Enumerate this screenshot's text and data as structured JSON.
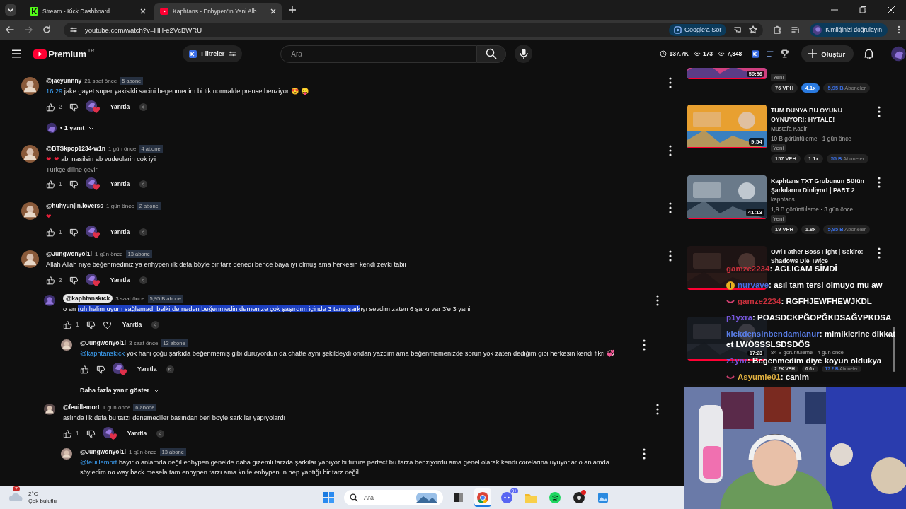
{
  "browser": {
    "tabs": [
      {
        "title": "Stream - Kick Dashboard",
        "kind": "kick",
        "selected": false
      },
      {
        "title": "Kaphtans - Enhypen'ın Yeni Alb",
        "kind": "youtube",
        "selected": true
      }
    ],
    "address": "youtube.com/watch?v=HH-e2VcBWRU",
    "ask_button": "Google'a Sor",
    "profile_button": "Kimliğinizi doğrulayın"
  },
  "header": {
    "logo": "Premium",
    "region": "TR",
    "filters": "Filtreler",
    "search": {
      "placeholder": "Ara"
    },
    "stats": [
      {
        "kind": "clock",
        "value": "137.7K"
      },
      {
        "kind": "eye",
        "value": "173"
      },
      {
        "kind": "eye",
        "value": "7,848"
      }
    ],
    "create": "Oluştur"
  },
  "comments": [
    {
      "author": "@jaeyunnny",
      "owner": false,
      "time": "21 saat önce",
      "subscribers": "5 abone",
      "segments": [
        {
          "kind": "link",
          "text": "16:29"
        },
        {
          "kind": "plain",
          "text": " jake gayet super yakisikli sacini begenmedim bi tik normalde prense benziyor 😍 😛"
        }
      ],
      "likes": "2",
      "hearted": true,
      "reply_label": "Yanıtla",
      "replies_toggle": "• 1 yanıt"
    },
    {
      "author": "@BTSkpop1234-w1n",
      "owner": false,
      "time": "1 gün önce",
      "subscribers": "4 abone",
      "segments": [
        {
          "kind": "heart",
          "text": "❤ ❤"
        },
        {
          "kind": "plain",
          "text": " abi nasilsin ab vudeolarin cok iyii"
        }
      ],
      "translate": "Türkçe diline çevir",
      "likes": "1",
      "hearted": true,
      "reply_label": "Yanıtla"
    },
    {
      "author": "@huhyunjin.loverss",
      "owner": false,
      "time": "1 gün önce",
      "subscribers": "2 abone",
      "segments": [
        {
          "kind": "heart",
          "text": "❤"
        }
      ],
      "likes": "1",
      "hearted": true,
      "reply_label": "Yanıtla"
    },
    {
      "author": "@Jungwonyoi1i",
      "owner": false,
      "time": "1 gün önce",
      "subscribers": "13 abone",
      "segments": [
        {
          "kind": "plain",
          "text": "Allah Allah niye beğenmediniz ya enhypen ilk defa böyle bir tarz denedi bence baya iyi olmuş ama herkesin kendi zevki tabii"
        }
      ],
      "likes": "2",
      "hearted": true,
      "reply_label": "Yanıtla",
      "children": [
        {
          "author": "@kaphtanskick",
          "owner": true,
          "time": "3 saat önce",
          "subscribers": "5,95 B abone",
          "segments": [
            {
              "kind": "plain",
              "text": "o an "
            },
            {
              "kind": "selected",
              "text": "ruh halim uyum sağlamadı belki de neden beğenmedin demenize çok şaşırdım içinde 3 tane şark"
            },
            {
              "kind": "plain",
              "text": "ıyı sevdim zaten 6 şarkı var 3'e 3 yani"
            }
          ],
          "likes": "1",
          "hearted": false,
          "reply_label": "Yanıtla",
          "children": [
            {
              "author": "@Jungwonyoi1i",
              "owner": false,
              "time": "3 saat önce",
              "subscribers": "13 abone",
              "segments": [
                {
                  "kind": "link",
                  "text": "@kaphtanskick"
                },
                {
                  "kind": "plain",
                  "text": " yok hani çoğu şarkıda beğenmemiş gibi duruyordun da chatte aynı şekildeydi ondan yazdım ama beğenmemenizde sorun yok zaten dediğim gibi herkesin kendi fikri 💞"
                }
              ],
              "hearted": true,
              "reply_label": "Yanıtla"
            }
          ],
          "more_replies": "Daha fazla yanıt göster"
        },
        {
          "author": "@feuillemort",
          "owner": false,
          "time": "1 gün önce",
          "subscribers": "6 abone",
          "segments": [
            {
              "kind": "plain",
              "text": "aslında ilk defa bu tarzı denemediler basından beri boyle sarkılar yapıyolardı"
            }
          ],
          "likes": "1",
          "hearted": true,
          "reply_label": "Yanıtla",
          "children": [
            {
              "author": "@Jungwonyoi1i",
              "owner": false,
              "time": "1 gün önce",
              "subscribers": "13 abone",
              "segments": [
                {
                  "kind": "link",
                  "text": "@feuillemort"
                },
                {
                  "kind": "plain",
                  "text": " hayır o anlamda değil enhypen genelde daha gizemli tarzda şarkılar yapıyor bi future perfect bu tarza benziyordu ama genel olarak kendi corelarına uyuyorlar o anlamda söyledim no way back mesela tam enhypen tarzı ama knife enhypen ın hep yaptığı bir tarz değil"
                }
              ]
            }
          ]
        }
      ]
    }
  ],
  "sidebar": {
    "videos": [
      {
        "duration": "59:56",
        "badge": "Yeni",
        "stats": [
          {
            "kind": "plain",
            "text": "76 VPH"
          },
          {
            "kind": "highlight",
            "text": "4.1x"
          }
        ],
        "subscribers": {
          "number": "5,95 B",
          "label": "Aboneler"
        }
      },
      {
        "duration": "9:54",
        "title": "TÜM DÜNYA BU OYUNU OYNUYOR!: HYTALE!",
        "channel": "Mustafa Kadir",
        "meta": "10 B görüntüleme · 1 gün önce",
        "badge": "Yeni",
        "stats": [
          {
            "kind": "plain",
            "text": "157 VPH"
          },
          {
            "kind": "plain",
            "text": "1.1x"
          }
        ],
        "subscribers": {
          "number": "55 B",
          "label": "Aboneler"
        }
      },
      {
        "duration": "41:13",
        "title": "Kaphtans TXT Grubunun Bütün Şarkılarını Dinliyor! | PART 2",
        "channel": "kaphtans",
        "meta": "1,9 B görüntüleme · 3 gün önce",
        "badge": "Yeni",
        "stats": [
          {
            "kind": "plain",
            "text": "19 VPH"
          },
          {
            "kind": "plain",
            "text": "1.8x"
          }
        ],
        "subscribers": {
          "number": "5,95 B",
          "label": "Aboneler"
        }
      },
      {
        "title": "Owl Father Boss Fight | Sekiro: Shadows Die Twice"
      },
      {
        "duration": "17:23",
        "meta": "84 B görüntüleme · 4 gün önce",
        "stats": [
          {
            "kind": "plain",
            "text": "2.2K VPH"
          },
          {
            "kind": "plain",
            "text": "0.6x"
          }
        ],
        "subscribers": {
          "number": "17.2 B",
          "label": "Aboneler"
        }
      }
    ]
  },
  "chat": [
    {
      "kind": "plain",
      "user": "gamze2234",
      "color": "#c8303c",
      "message": ": AGLICAM SİMDİ"
    },
    {
      "kind": "sub",
      "user": "nurvave",
      "color": "#4a6ee0",
      "message": ": asıl tam tersi olmuyo mu aw"
    },
    {
      "kind": "smile",
      "user": "gamze2234",
      "color": "#c8303c",
      "message": ": RGFHJEWFHEWJKDL"
    },
    {
      "kind": "plain",
      "user": "p1yxra",
      "color": "#7a58e0",
      "message": ": POASDCKPĞOPĞKDSAĞVPKDSA"
    },
    {
      "kind": "plain",
      "user": "kickdensinbendamlanur",
      "color": "#5a7ee8",
      "message": ": mimiklerine dikkat et LWÖSSSLSDSDÖS"
    },
    {
      "kind": "plain",
      "user": "z1ynr",
      "color": "#7a58e0",
      "message": ": Beğenmedim diye koyun oldukya"
    },
    {
      "kind": "smile",
      "user": "Asyumie01",
      "color": "#e0b040",
      "message": ": canim"
    }
  ],
  "taskbar": {
    "weather": {
      "badge": "7",
      "temperature": "2°C",
      "condition": "Çok bulutlu"
    },
    "search": {
      "placeholder": "Ara"
    },
    "apps": [
      {
        "kind": "start",
        "active": false
      },
      {
        "kind": "taskview",
        "active": false
      },
      {
        "kind": "chrome",
        "active": true
      },
      {
        "kind": "discord",
        "active": false,
        "badge": "9+"
      },
      {
        "kind": "folder",
        "active": false
      },
      {
        "kind": "spotify",
        "active": false
      },
      {
        "kind": "obs",
        "active": false,
        "notify": true
      },
      {
        "kind": "photos",
        "active": false
      }
    ]
  }
}
